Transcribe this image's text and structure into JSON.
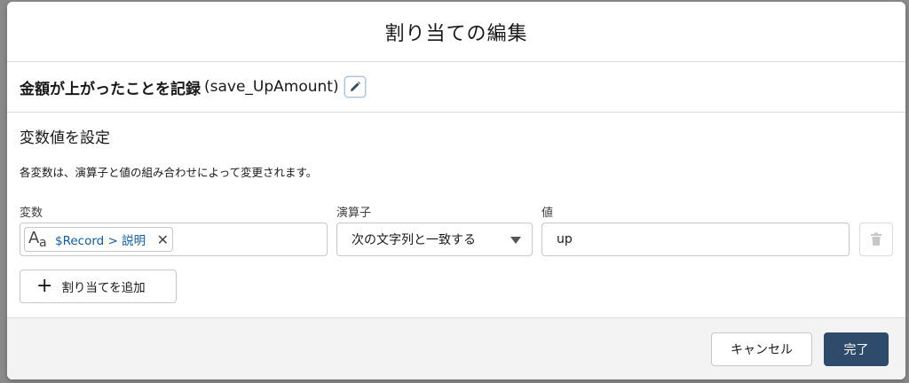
{
  "modal": {
    "title": "割り当ての編集"
  },
  "element": {
    "label": "金額が上がったことを記録",
    "api_name": "(save_UpAmount)"
  },
  "section": {
    "title": "変数値を設定",
    "description": "各変数は、演算子と値の組み合わせによって変更されます。"
  },
  "columns": {
    "variable": "変数",
    "operator": "演算子",
    "value": "値"
  },
  "assignment": {
    "variable_icon": "text-type-icon",
    "variable_icon_big": "A",
    "variable_icon_small": "a",
    "variable": "$Record > 説明",
    "operator": "次の文字列と一致する",
    "value": "up"
  },
  "add_button": {
    "label": "割り当てを追加"
  },
  "footer": {
    "cancel_label": "キャンセル",
    "done_label": "完了"
  },
  "colors": {
    "brand": "#2e4b6b",
    "link": "#0b5cab"
  }
}
